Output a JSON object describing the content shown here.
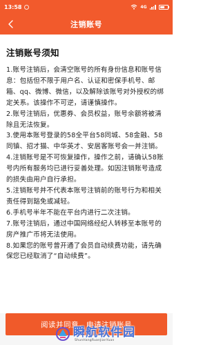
{
  "status_bar": {
    "time": "13:58",
    "network": "4G"
  },
  "header": {
    "back_icon": "chevron-left-icon",
    "title": "注销账号"
  },
  "notice": {
    "title": "注销账号须知",
    "terms": [
      "1.账号注销后，会清空账号的所有身份信息和账号信息：包括但不限于用户名、认证和密保手机号、邮箱、qq、微博、微信，以及解除该账号对外授权的绑定关系。该操作不可逆，请谨慎操作。",
      "2.账号注销后，优惠券、会员权益，账号余额将被清除且无法恢复。",
      "3.使用本账号登录的58全平台58同城、58金融、58同镇、招才猫、中华英才、安居客账号会一并注销。",
      "4.注销账号是不可恢复操作，操作之前，请确认58账号内所有服务均已进行妥善处理。如因注销账号造成的损失由用户自行承担。",
      "5.注销账号并不代表本账号注销前的账号行为和相关责任得到豁免或减轻。",
      "6.手机号半年不能在平台内进行二次注销。",
      "7.账号注销后，通过中国网络经纪人转移至本账号的房产推广币将无法使用。",
      "8.如果您的账号曾开通了会员自动续费功能，请先确保您已经取消了“自动续费”。"
    ]
  },
  "footer": {
    "agree_button_label": "阅读并同意，申请注销账号"
  },
  "watermark": {
    "text": "瞬航软件园",
    "subtext": "ShunHangRuanJianYuan"
  },
  "colors": {
    "primary": "#f25a2c",
    "button": "#f05a2a",
    "watermark_text": "#4a73d6"
  }
}
